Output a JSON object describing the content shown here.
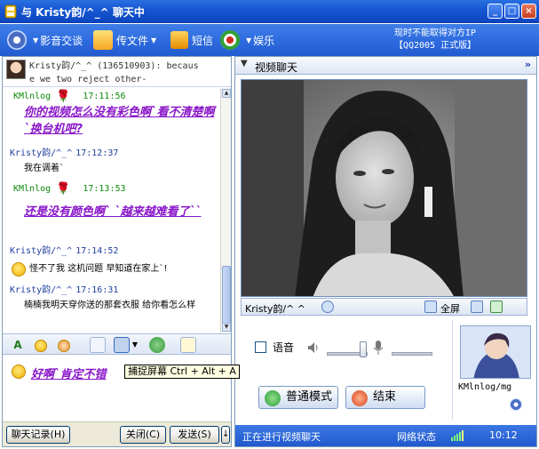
{
  "window": {
    "title": "与 Kristy韵/^_^ 聊天中",
    "min_label": "_",
    "max_label": "□",
    "close_label": "×"
  },
  "toolbar": {
    "items": [
      {
        "label": "影音交谈",
        "icon": "webcam-icon"
      },
      {
        "label": "传文件",
        "icon": "file-transfer-icon"
      },
      {
        "label": "短信",
        "icon": "sms-icon"
      },
      {
        "label": "娱乐",
        "icon": "entertainment-icon"
      }
    ],
    "ad_line1": "现时不能取得对方IP",
    "ad_line2": "【QQ2005 正式版】"
  },
  "signature": {
    "text": "Kristy韵/^_^ (136510903): becaus\ne we two reject other-"
  },
  "chat": {
    "messages": [
      {
        "sender": "KMlnlog",
        "time": "17:11:56",
        "text": "你的视频怎么没有彩色啊`看不清楚啊`换台机吧?",
        "me": true
      },
      {
        "sender": "Kristy韵/^_^",
        "time": "17:12:37",
        "text": "我在调着`",
        "me": false
      },
      {
        "sender": "KMlnlog",
        "time": "17:13:53",
        "text": "还是没有颜色啊` `越来越难看了``",
        "me": true
      },
      {
        "sender": "Kristy韵/^_^",
        "time": "17:14:52",
        "text": "怪不了我 这机问题 早知道在家上`!",
        "me": false
      },
      {
        "sender": "Kristy韵/^_^",
        "time": "17:16:31",
        "text": "楠楠我明天穿你送的那套衣服 给你看怎么样",
        "me": false
      }
    ]
  },
  "input": {
    "text": "好啊`肯定不错"
  },
  "tooltip": {
    "text": "捕捉屏幕 Ctrl + Alt + A"
  },
  "buttons": {
    "history": "聊天记录(H)",
    "close": "关闭(C)",
    "send": "发送(S)",
    "send_arrow": "↓"
  },
  "video": {
    "header": "视频聊天",
    "peer_name": "Kristy韵/^ ^",
    "fullscreen": "全屏",
    "voice_label": "语音",
    "normal_mode": "普通模式",
    "end": "结束",
    "self_name": "KMlnlog/mg"
  },
  "status": {
    "left": "正在进行视频聊天",
    "network": "网络状态",
    "clock": "10:12"
  },
  "colors": {
    "titlebar": "#1556d2",
    "my_msg": "#8a17c9",
    "my_header": "#0c8a0c",
    "other_header": "#1f3da0"
  }
}
